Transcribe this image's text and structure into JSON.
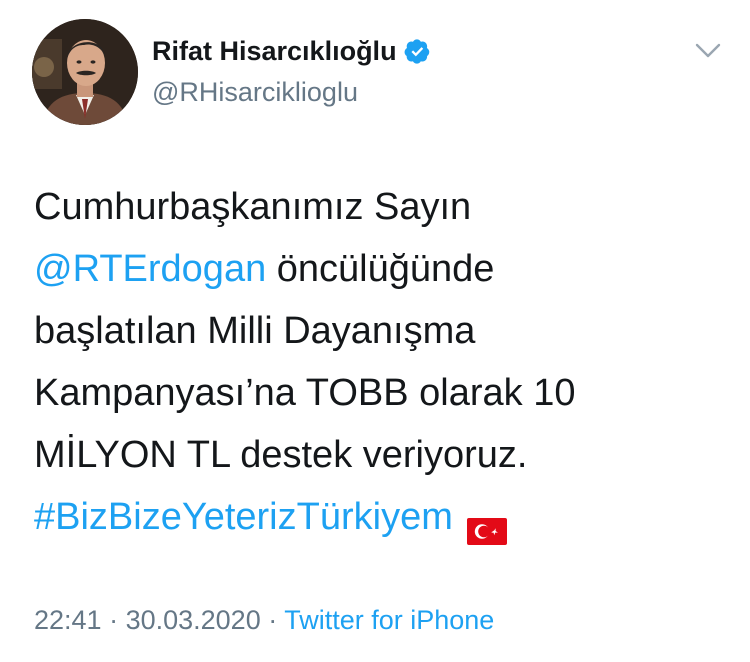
{
  "author": {
    "name": "Rifat Hisarcıklıoğlu",
    "handle": "@RHisarciklioglu",
    "verified": true
  },
  "tweet": {
    "line1": "Cumhurbaşkanımız Sayın",
    "mention": "@RTErdogan",
    "line2_rest": " öncülüğünde",
    "line3": "başlatılan Milli Dayanışma",
    "line4": "Kampanyası’na TOBB olarak 10",
    "line5": "MİLYON TL destek veriyoruz.",
    "hashtag": "#BizBizeYeterizTürkiyem",
    "flag_icon": "turkey-flag-emoji"
  },
  "meta": {
    "time": "22:41",
    "separator1": " · ",
    "date": "30.03.2020",
    "separator2": " · ",
    "source": "Twitter for iPhone"
  },
  "colors": {
    "link": "#1da1f2",
    "secondary": "#657786",
    "text": "#14171a",
    "flag": "#e30a17"
  },
  "icons": {
    "verified": "verified-badge-icon",
    "menu": "chevron-down-icon"
  }
}
